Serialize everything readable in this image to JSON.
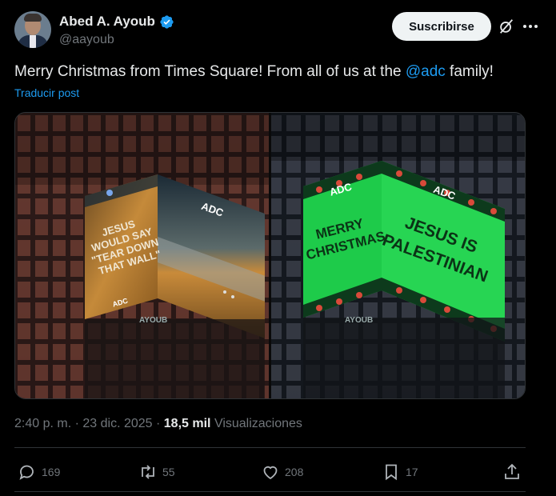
{
  "author": {
    "name": "Abed A. Ayoub",
    "handle": "@aayoub"
  },
  "subscribe_label": "Suscribirse",
  "tweet": {
    "text_before": "Merry Christmas from Times Square! From all of us at the ",
    "mention": "@adc",
    "text_after": " family!",
    "translate_label": "Traducir post"
  },
  "media": {
    "left_billboard": {
      "quote": [
        "JESUS",
        "WOULD SAY",
        "\"TEAR DOWN",
        "THAT WALL\""
      ],
      "logo": "ADC",
      "logo_small": "ADC"
    },
    "right_billboard": {
      "left_face": [
        "MERRY",
        "CHRISTMAS"
      ],
      "right_face": [
        "JESUS IS",
        "PALESTINIAN"
      ],
      "logo_left": "ADC",
      "logo_right": "ADC"
    },
    "building_sign_left": "AYOUB",
    "building_sign_right": "AYOUB"
  },
  "meta": {
    "time": "2:40 p. m.",
    "separator": " · ",
    "date": "23 dic. 2025",
    "views_count": "18,5 mil",
    "views_label": "Visualizaciones"
  },
  "actions": {
    "replies": "169",
    "reposts": "55",
    "likes": "208",
    "bookmarks": "17"
  },
  "colors": {
    "accent": "#1d9bf0",
    "background": "#000000",
    "text": "#e7e9ea",
    "muted": "#71767b",
    "billboard_green": "#1ecb4a"
  },
  "icons": [
    "verified-icon",
    "grok-icon",
    "more-icon",
    "reply-icon",
    "repost-icon",
    "like-icon",
    "bookmark-icon",
    "share-icon"
  ]
}
